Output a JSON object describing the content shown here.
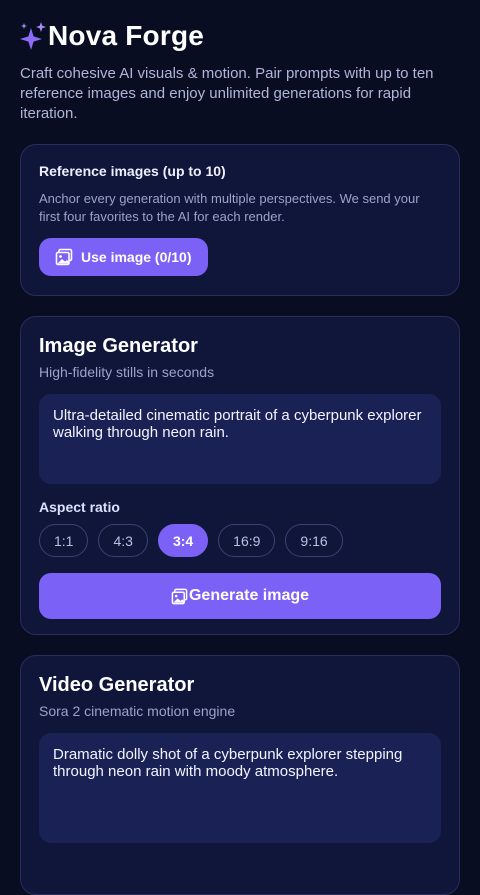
{
  "app": {
    "title": "Nova Forge",
    "tagline": "Craft cohesive AI visuals & motion. Pair prompts with up to ten reference images and enjoy unlimited generations for rapid iteration."
  },
  "reference": {
    "title": "Reference images (up to 10)",
    "description": "Anchor every generation with multiple perspectives. We send your first four favorites to the AI for each render.",
    "button_label": "Use image (0/10)"
  },
  "image_generator": {
    "title": "Image Generator",
    "subtitle": "High-fidelity stills in seconds",
    "prompt": "Ultra-detailed cinematic portrait of a cyberpunk explorer walking through neon rain.",
    "aspect_label": "Aspect ratio",
    "ratios": [
      "1:1",
      "4:3",
      "3:4",
      "16:9",
      "9:16"
    ],
    "selected_ratio": "3:4",
    "generate_label": "Generate image"
  },
  "video_generator": {
    "title": "Video Generator",
    "subtitle": "Sora 2 cinematic motion engine",
    "prompt": "Dramatic dolly shot of a cyberpunk explorer stepping through neon rain with moody atmosphere."
  },
  "colors": {
    "background": "#090d22",
    "card": "#10163a",
    "accent": "#7b61f5",
    "input": "#1a2155"
  },
  "icons": {
    "logo": "sparkles-icon",
    "image": "image-icon"
  }
}
